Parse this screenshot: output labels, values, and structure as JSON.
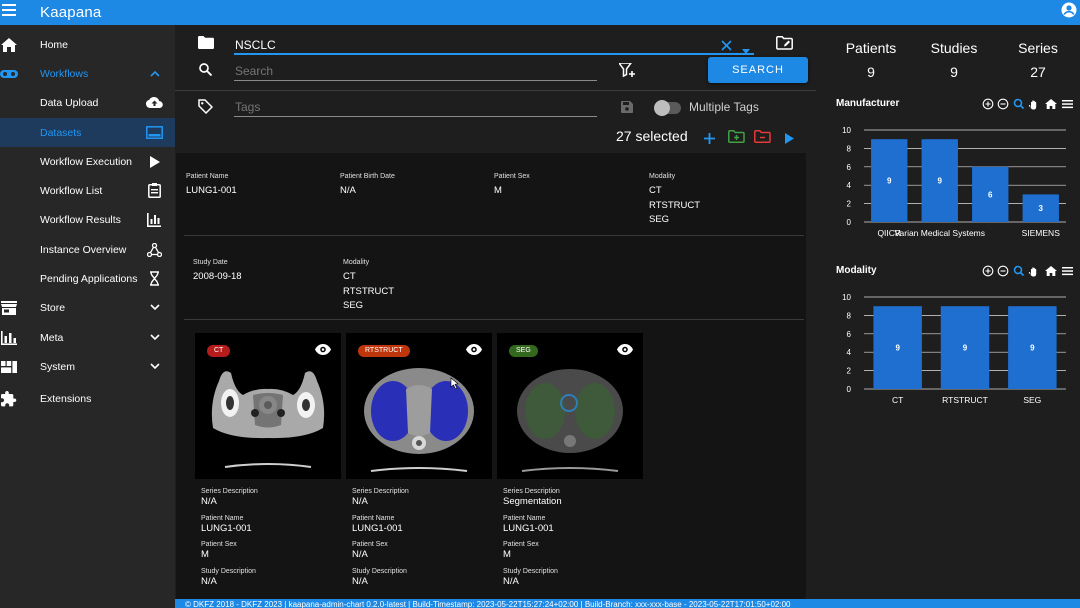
{
  "app": {
    "title": "Kaapana"
  },
  "sidebar": {
    "items": [
      {
        "label": "Home",
        "icon": "home-icon"
      },
      {
        "label": "Workflows",
        "icon": "workflows-icon"
      },
      {
        "label": "Data Upload",
        "icon": "cloud-upload-icon"
      },
      {
        "label": "Datasets",
        "icon": "datasets-icon"
      },
      {
        "label": "Workflow Execution",
        "icon": "play-icon"
      },
      {
        "label": "Workflow List",
        "icon": "clipboard-list-icon"
      },
      {
        "label": "Workflow Results",
        "icon": "bar-chart-icon"
      },
      {
        "label": "Instance Overview",
        "icon": "network-icon"
      },
      {
        "label": "Pending Applications",
        "icon": "hourglass-icon"
      },
      {
        "label": "Store",
        "icon": "store-icon"
      },
      {
        "label": "Meta",
        "icon": "meta-chart-icon"
      },
      {
        "label": "System",
        "icon": "system-icon"
      },
      {
        "label": "Extensions",
        "icon": "puzzle-icon"
      }
    ]
  },
  "filter": {
    "dataset_value": "NSCLC",
    "search_placeholder": "Search",
    "search_button": "SEARCH",
    "tags_placeholder": "Tags",
    "multiple_tags_label": "Multiple Tags",
    "multiple_tags_on": false,
    "selected_count": "27 selected"
  },
  "patient": {
    "name_key": "Patient Name",
    "name": "LUNG1-001",
    "birth_key": "Patient Birth Date",
    "birth": "N/A",
    "sex_key": "Patient Sex",
    "sex": "M",
    "modality_key": "Modality",
    "modalities": "CT\nRTSTRUCT\nSEG"
  },
  "study": {
    "date_key": "Study Date",
    "date": "2008-09-18",
    "modality_key": "Modality",
    "modalities": "CT\nRTSTRUCT\nSEG"
  },
  "series": [
    {
      "chip": "CT",
      "chip_color": "#b71c1c",
      "desc_key": "Series Description",
      "desc": "N/A",
      "name_key": "Patient Name",
      "name": "LUNG1-001",
      "sex_key": "Patient Sex",
      "sex": "M",
      "study_key": "Study Description",
      "study": "N/A"
    },
    {
      "chip": "RTSTRUCT",
      "chip_color": "#bf360c",
      "desc_key": "Series Description",
      "desc": "N/A",
      "name_key": "Patient Name",
      "name": "LUNG1-001",
      "sex_key": "Patient Sex",
      "sex": "N/A",
      "study_key": "Study Description",
      "study": "N/A"
    },
    {
      "chip": "SEG",
      "chip_color": "#33691e",
      "desc_key": "Series Description",
      "desc": "Segmentation",
      "name_key": "Patient Name",
      "name": "LUNG1-001",
      "sex_key": "Patient Sex",
      "sex": "M",
      "study_key": "Study Description",
      "study": "N/A"
    }
  ],
  "stats": {
    "patients_label": "Patients",
    "patients": "9",
    "studies_label": "Studies",
    "studies": "9",
    "series_label": "Series",
    "series": "27"
  },
  "chart_data": [
    {
      "type": "bar",
      "title": "Manufacturer",
      "categories": [
        "QIICR",
        "Varian Medical Systems",
        "",
        "SIEMENS"
      ],
      "values": [
        9,
        9,
        6,
        3
      ],
      "ylim": [
        0,
        10
      ],
      "yticks": [
        0,
        2,
        4,
        6,
        8,
        10
      ],
      "color": "#1e6fd0",
      "grid": true
    },
    {
      "type": "bar",
      "title": "Modality",
      "categories": [
        "CT",
        "RTSTRUCT",
        "SEG"
      ],
      "values": [
        9,
        9,
        9
      ],
      "ylim": [
        0,
        10
      ],
      "yticks": [
        0,
        2,
        4,
        6,
        8,
        10
      ],
      "color": "#1e6fd0",
      "grid": true
    }
  ],
  "footer": {
    "text": "© DKFZ 2018 - DKFZ 2023 | kaapana-admin-chart 0.2.0-latest | Build-Timestamp: 2023-05-22T15:27:24+02:00 | Build-Branch: xxx-xxx-base - 2023-05-22T17:01:50+02:00"
  }
}
